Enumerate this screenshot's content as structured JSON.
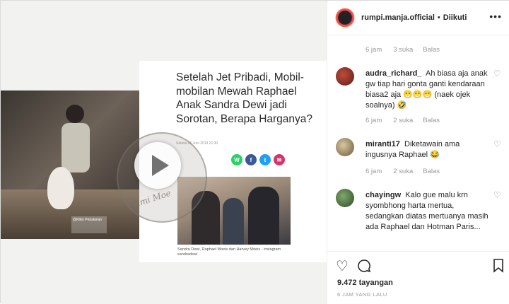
{
  "article": {
    "title": "Setelah Jet Pribadi, Mobil-mobilan Mewah Raphael Anak Sandra Dewi jadi Sorotan, Berapa Harganya?",
    "date": "Selasa 25 Juni 2019 21:30",
    "photo_caption": "Sandra Dewi, Raphael Moeis dan Harvey Moeis - instagram sandradewi",
    "share_buttons": [
      "W",
      "f",
      "t",
      "✉"
    ]
  },
  "video": {
    "overlay_text": "@Kliko Perjalanan"
  },
  "watermark": "Mimi Moe",
  "header": {
    "username": "rumpi.manja.official",
    "separator": "•",
    "follow_status": "Diikuti",
    "more": "•••"
  },
  "top_meta": {
    "time": "6 jam",
    "likes": "3 suka",
    "reply": "Balas"
  },
  "comments": [
    {
      "username": "audra_richard_",
      "text": "Ah biasa aja anak gw tiap hari gonta ganti kendaraan biasa2 aja 😁😁😁 (naek ojek soalnya) 🤣",
      "time": "6 jam",
      "likes": "2 suka",
      "reply": "Balas"
    },
    {
      "username": "miranti17",
      "text": "Diketawain ama ingusnya Raphael 😂",
      "time": "6 jam",
      "likes": "2 suka",
      "reply": "Balas"
    },
    {
      "username": "chayingw",
      "text": "Kalo gue malu krn syombhong harta mertua, sedangkan diatas mertuanya masih ada Raphael dan Hotman Paris...",
      "time": "",
      "likes": "",
      "reply": ""
    }
  ],
  "footer": {
    "views": "9.472 tayangan",
    "posted": "6 JAM YANG LALU"
  },
  "icons": {
    "heart": "heart-icon",
    "comment": "comment-icon",
    "bookmark": "bookmark-icon",
    "play": "play-icon",
    "more": "more-icon"
  }
}
